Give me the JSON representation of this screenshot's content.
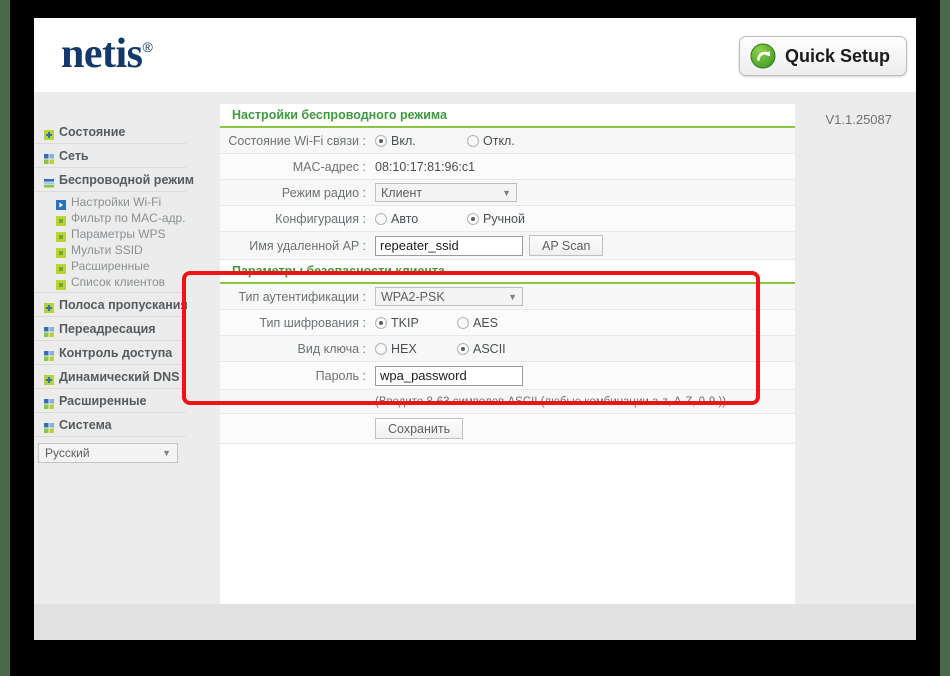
{
  "brand": {
    "logo_text": "netis",
    "logo_mark": "®"
  },
  "header": {
    "quick_setup_label": "Quick Setup",
    "quick_setup_icon": "refresh-arrow-icon"
  },
  "version": "V1.1.25087",
  "sidebar": {
    "items": [
      {
        "label": "Состояние",
        "icon": "green-square-plus-icon"
      },
      {
        "label": "Сеть",
        "icon": "green-blue-grid-icon"
      },
      {
        "label": "Беспроводной режим",
        "icon": "green-bars-icon",
        "expanded": true
      },
      {
        "label": "Полоса пропускания",
        "icon": "green-square-plus-icon"
      },
      {
        "label": "Переадресация",
        "icon": "green-blue-grid-icon"
      },
      {
        "label": "Контроль доступа",
        "icon": "green-blue-grid-icon"
      },
      {
        "label": "Динамический DNS",
        "icon": "green-square-plus-icon"
      },
      {
        "label": "Расширенные",
        "icon": "green-blue-grid-icon"
      },
      {
        "label": "Система",
        "icon": "green-blue-grid-icon"
      }
    ],
    "submenu": [
      {
        "label": "Настройки Wi-Fi",
        "icon": "blue-arrow-icon",
        "active": true
      },
      {
        "label": "Фильтр по MAC-адр.",
        "icon": "green-square-icon",
        "active": false
      },
      {
        "label": "Параметры WPS",
        "icon": "green-square-icon",
        "active": false
      },
      {
        "label": "Мульти SSID",
        "icon": "green-square-icon",
        "active": false
      },
      {
        "label": "Расширенные",
        "icon": "green-square-icon",
        "active": false
      },
      {
        "label": "Список клиентов",
        "icon": "green-square-icon",
        "active": false
      }
    ],
    "language": {
      "value": "Русский",
      "caret": "▼"
    }
  },
  "wireless_section": {
    "title": "Настройки беспроводного режима",
    "wifi_state": {
      "label": "Состояние Wi-Fi связи :",
      "options": [
        {
          "label": "Вкл.",
          "selected": true
        },
        {
          "label": "Откл.",
          "selected": false
        }
      ]
    },
    "mac_address": {
      "label": "MAC-адрес :",
      "value": "08:10:17:81:96:c1"
    },
    "radio_mode": {
      "label": "Режим радио :",
      "value": "Клиент",
      "caret": "▼"
    },
    "configuration": {
      "label": "Конфигурация :",
      "options": [
        {
          "label": "Авто",
          "selected": false
        },
        {
          "label": "Ручной",
          "selected": true
        }
      ]
    },
    "remote_ap": {
      "label": "Имя удаленной AP :",
      "value": "repeater_ssid",
      "scan_button": "AP Scan"
    }
  },
  "security_section": {
    "title": "Параметры безопасности клиента",
    "auth_type": {
      "label": "Тип аутентификации :",
      "value": "WPA2-PSK",
      "caret": "▼"
    },
    "encryption_type": {
      "label": "Тип шифрования :",
      "options": [
        {
          "label": "TKIP",
          "selected": true
        },
        {
          "label": "AES",
          "selected": false
        }
      ]
    },
    "key_format": {
      "label": "Вид ключа :",
      "options": [
        {
          "label": "HEX",
          "selected": false
        },
        {
          "label": "ASCII",
          "selected": true
        }
      ]
    },
    "password": {
      "label": "Пароль :",
      "value": "wpa_password"
    },
    "hint": "(Введите 8-63 символов ASCII (любые комбинации a-z, A-Z, 0-9.))",
    "save_button": "Сохранить"
  },
  "annotation": {
    "highlight_color": "#f01414"
  }
}
